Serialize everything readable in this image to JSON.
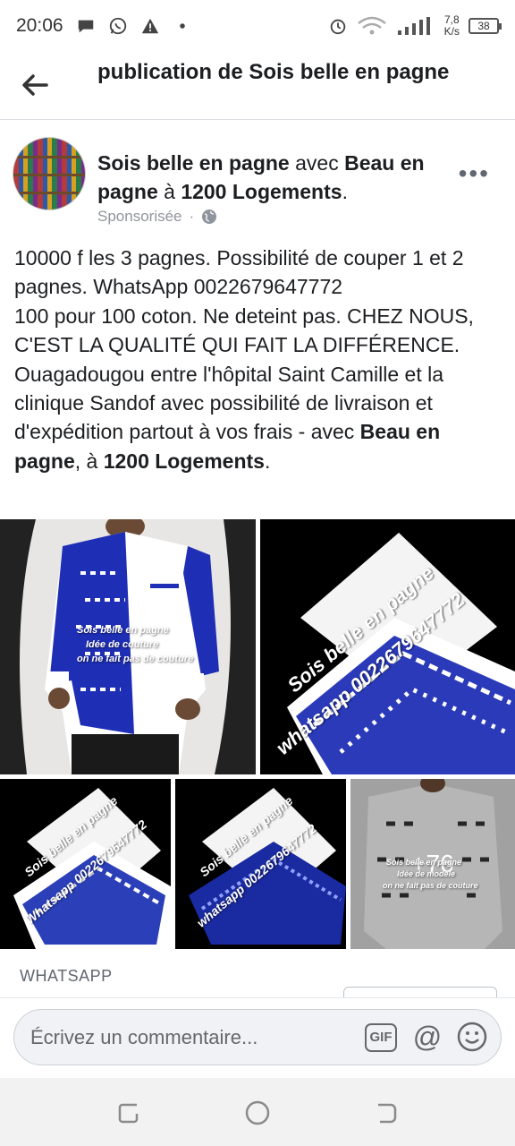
{
  "status_bar": {
    "time": "20:06",
    "network_speed_value": "7,8",
    "network_speed_unit": "K/s",
    "battery": "38"
  },
  "header": {
    "title": "publication de Sois belle en pagne"
  },
  "post": {
    "page_name": "Sois belle en pagne",
    "with_word": " avec ",
    "tagged_page": "Beau en pagne",
    "at_word": " à ",
    "location": "1200 Logements",
    "end_period": ".",
    "sponsored": "Sponsorisée",
    "separator": "·",
    "body_lines": [
      "10000 f les 3 pagnes. Possibilité de couper 1 et 2 pagnes. WhatsApp 0022679647772",
      "100 pour 100 coton. Ne deteint pas. CHEZ NOUS, C'EST LA QUALITÉ QUI FAIT LA DIFFÉRENCE.",
      "Ouagadougou entre l'hôpital Saint Camille et la clinique Sandof avec possibilité de livraison et d'expédition partout à vos frais - "
    ],
    "body_with": "avec ",
    "body_tagged": "Beau en pagne",
    "body_at": ", à ",
    "body_location": "1200 Logements",
    "body_end": ".",
    "images": {
      "wm1_line1": "Sois belle en pagne",
      "wm1_line2": "Idée de couture",
      "wm1_line3": "on ne fait pas de couture",
      "wm2_line1": "Sois belle en pagne",
      "wm2_line2": "whatsapp 0022679647772",
      "wm3_line1": "Sois belle en pagne",
      "wm3_line2": "Whatsapp 0022679647772",
      "wm4_line1": "Sois belle en pagne",
      "wm4_line2": "whatsapp 0022679647772",
      "wm5_line1": "Sois belle en pagne",
      "wm5_line2": "Idée de modèle",
      "wm5_line3": "on ne fait pas de couture",
      "more_count": "+76"
    },
    "link_label": "WHATSAPP"
  },
  "comment": {
    "placeholder": "Écrivez un commentaire...",
    "gif_label": "GIF",
    "at_label": "@"
  },
  "colors": {
    "blue_fabric": "#1f2fb5",
    "accent": "#1877f2"
  }
}
